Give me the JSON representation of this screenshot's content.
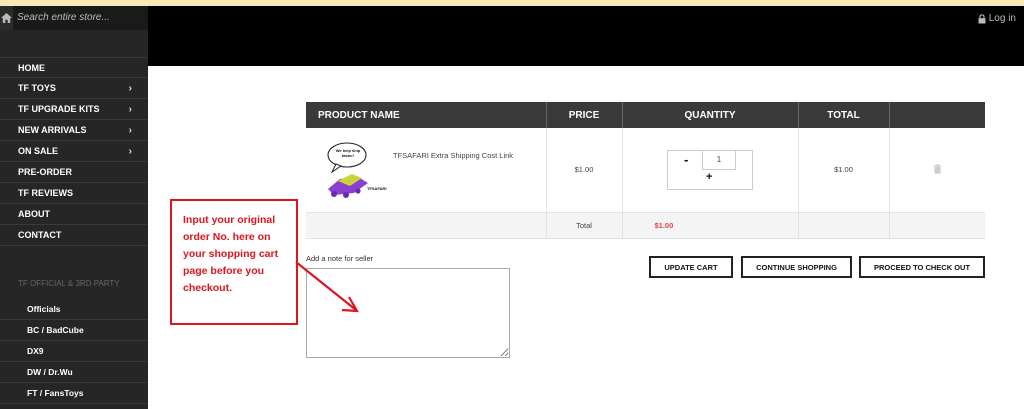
{
  "search": {
    "placeholder": "Search entire store..."
  },
  "header": {
    "login_label": "Log in"
  },
  "sidebar": {
    "menu": [
      {
        "label": "HOME",
        "has_children": false
      },
      {
        "label": "TF TOYS",
        "has_children": true
      },
      {
        "label": "TF UPGRADE KITS",
        "has_children": true
      },
      {
        "label": "NEW ARRIVALS",
        "has_children": true
      },
      {
        "label": "ON SALE",
        "has_children": true
      },
      {
        "label": "PRE-ORDER",
        "has_children": false
      },
      {
        "label": "TF REVIEWS",
        "has_children": false
      },
      {
        "label": "ABOUT",
        "has_children": false
      },
      {
        "label": "CONTACT",
        "has_children": false
      }
    ],
    "section_title": "TF OFFICIAL & 3RD PARTY",
    "sub_items": [
      "Officials",
      "BC / BadCube",
      "DX9",
      "DW / Dr.Wu",
      "FT / FansToys"
    ]
  },
  "cart": {
    "headers": {
      "product": "PRODUCT NAME",
      "price": "PRICE",
      "quantity": "QUANTITY",
      "total": "TOTAL"
    },
    "item": {
      "name": "TFSAFARI Extra Shipping Cost Link",
      "price": "$1.00",
      "quantity": "1",
      "total": "$1.00",
      "thumb_bubble": "We help ship faster!",
      "thumb_logo": "TFSAFARI"
    },
    "total_label": "Total",
    "total_value": "$1.00",
    "minus": "-",
    "plus": "+"
  },
  "buttons": {
    "update": "UPDATE CART",
    "continue": "CONTINUE SHOPPING",
    "checkout": "PROCEED TO CHECK OUT"
  },
  "note": {
    "label": "Add a note for seller",
    "value": ""
  },
  "callout": {
    "text": "Input your original order No. here on your shopping cart page before you checkout."
  },
  "colors": {
    "accent_red": "#e0141e",
    "price_red": "#e04545",
    "sidebar_bg": "#262626",
    "header_bg": "#000000"
  }
}
